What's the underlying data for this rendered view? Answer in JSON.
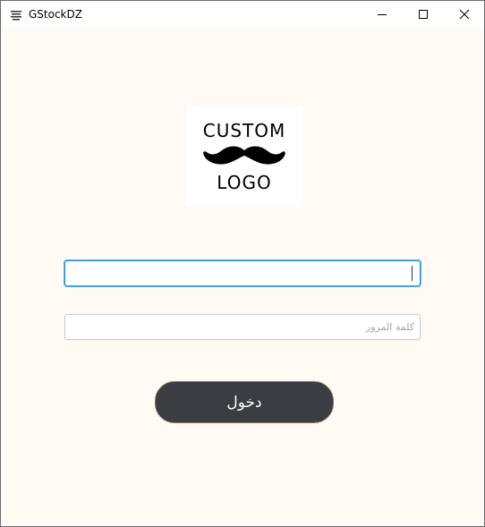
{
  "window": {
    "title": "GStockDZ"
  },
  "logo": {
    "line1": "CUSTOM",
    "line2": "LOGO"
  },
  "form": {
    "username": {
      "value": "",
      "placeholder": ""
    },
    "password": {
      "value": "",
      "placeholder": "كلمة المرور"
    },
    "login_label": "دخول"
  },
  "colors": {
    "background": "#fffaf4",
    "focus_border": "#1f93d6",
    "button_bg": "#3a3d42",
    "button_border": "#8a6e5c"
  }
}
